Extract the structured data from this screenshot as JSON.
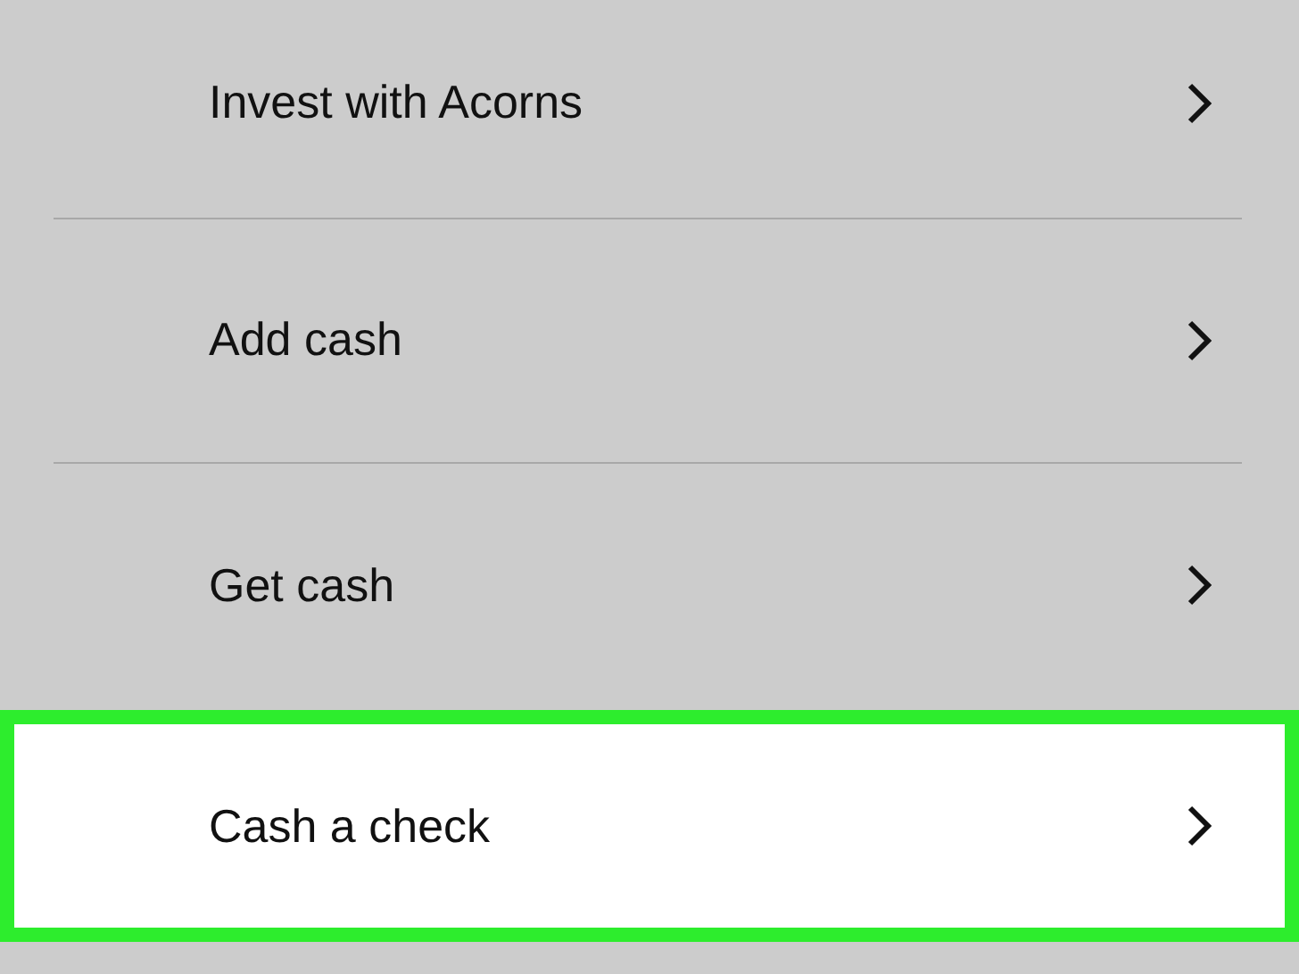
{
  "menu": [
    {
      "label": "Invest with Acorns",
      "selected": false
    },
    {
      "label": "Add cash",
      "selected": false
    },
    {
      "label": "Get cash",
      "selected": false
    },
    {
      "label": "Cash a check",
      "selected": true
    }
  ]
}
